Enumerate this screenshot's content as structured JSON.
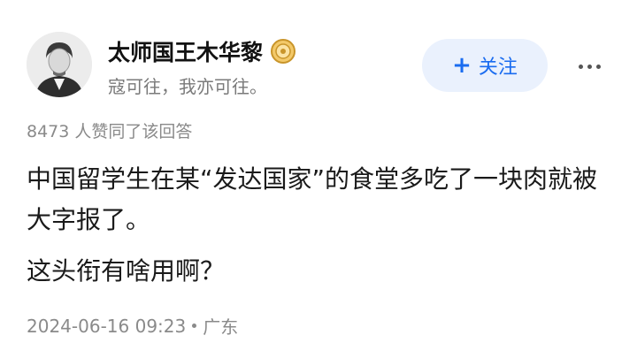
{
  "author": {
    "name": "太师国王木华黎",
    "bio": "寇可往，我亦可往。"
  },
  "actions": {
    "follow_plus": "+",
    "follow_label": "关注"
  },
  "likes_text": "8473 人赞同了该回答",
  "answer": {
    "paragraphs": [
      "中国留学生在某“发达国家”的食堂多吃了一块肉就被大字报了。",
      "这头衔有啥用啊？"
    ]
  },
  "meta": {
    "timestamp": "2024-06-16 09:23",
    "location": "广东"
  },
  "icons": {
    "avatar": "portrait-avatar",
    "badge": "gold-medal-badge-icon",
    "more": "more-dots-icon"
  },
  "colors": {
    "accent": "#1a6cf0",
    "follow_bg": "#eaf1fd",
    "muted_text": "#8a8a8a"
  }
}
